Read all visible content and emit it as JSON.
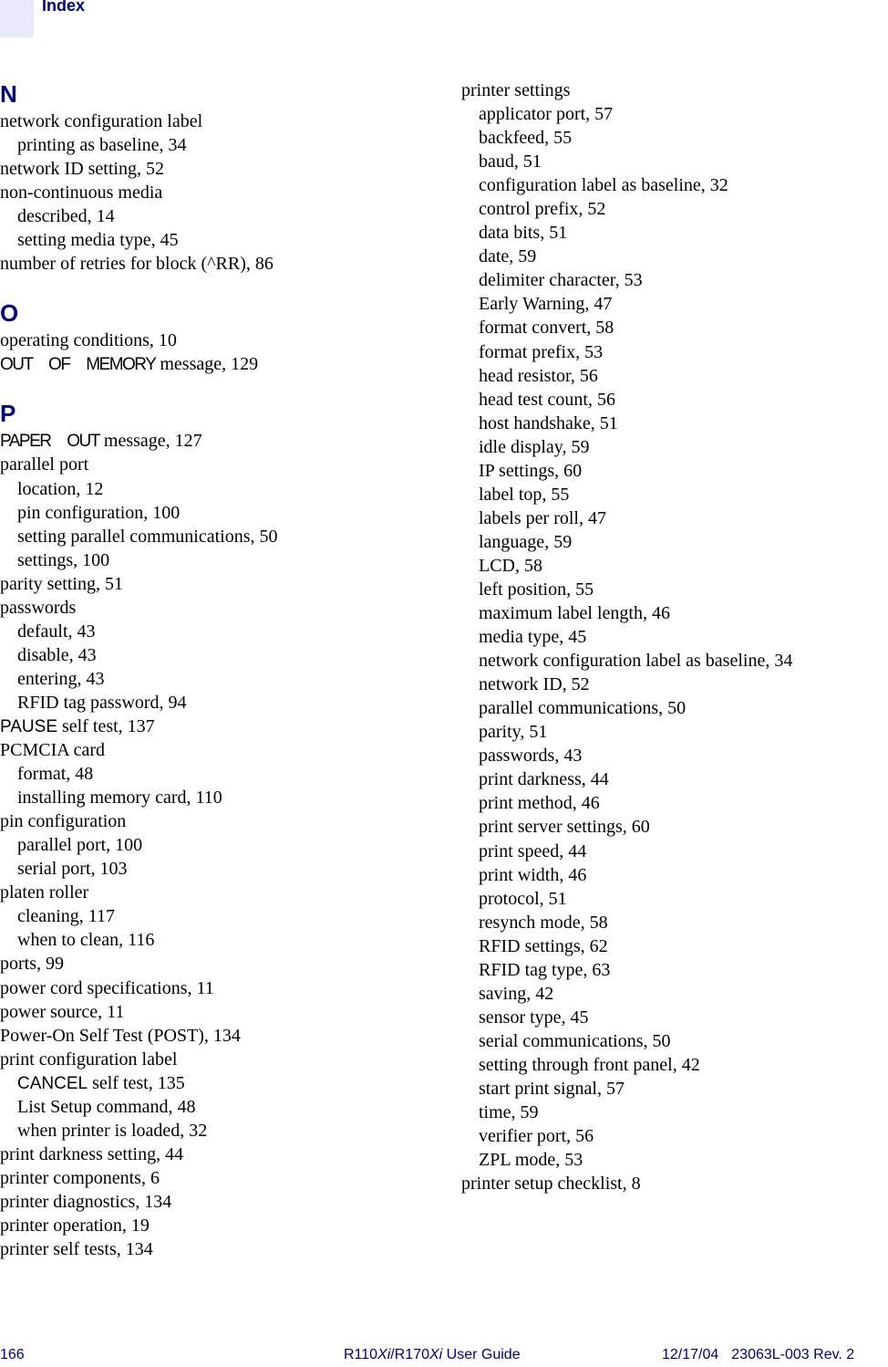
{
  "header": {
    "title": "Index"
  },
  "left_column": [
    {
      "type": "letter",
      "text": "N"
    },
    {
      "type": "entry",
      "level": 0,
      "text": "network configuration label"
    },
    {
      "type": "entry",
      "level": 1,
      "text": "printing as baseline, 34"
    },
    {
      "type": "entry",
      "level": 0,
      "text": "network ID setting, 52"
    },
    {
      "type": "entry",
      "level": 0,
      "text": "non-continuous media"
    },
    {
      "type": "entry",
      "level": 1,
      "text": "described, 14"
    },
    {
      "type": "entry",
      "level": 1,
      "text": "setting media type, 45"
    },
    {
      "type": "entry",
      "level": 0,
      "text": "number of retries for block (^RR), 86"
    },
    {
      "type": "gap"
    },
    {
      "type": "letter",
      "text": "O"
    },
    {
      "type": "entry",
      "level": 0,
      "text": "operating conditions, 10"
    },
    {
      "type": "entry",
      "level": 0,
      "sans": "OUT OF MEMORY",
      "condensed": true,
      "text": " message, 129"
    },
    {
      "type": "gap"
    },
    {
      "type": "letter",
      "text": "P"
    },
    {
      "type": "entry",
      "level": 0,
      "sans": "PAPER OUT",
      "condensed": true,
      "text": " message, 127"
    },
    {
      "type": "entry",
      "level": 0,
      "text": "parallel port"
    },
    {
      "type": "entry",
      "level": 1,
      "text": "location, 12"
    },
    {
      "type": "entry",
      "level": 1,
      "text": "pin configuration, 100"
    },
    {
      "type": "entry",
      "level": 1,
      "text": "setting parallel communications, 50"
    },
    {
      "type": "entry",
      "level": 1,
      "text": "settings, 100"
    },
    {
      "type": "entry",
      "level": 0,
      "text": "parity setting, 51"
    },
    {
      "type": "entry",
      "level": 0,
      "text": "passwords"
    },
    {
      "type": "entry",
      "level": 1,
      "text": "default, 43"
    },
    {
      "type": "entry",
      "level": 1,
      "text": "disable, 43"
    },
    {
      "type": "entry",
      "level": 1,
      "text": "entering, 43"
    },
    {
      "type": "entry",
      "level": 1,
      "text": "RFID tag password, 94"
    },
    {
      "type": "entry",
      "level": 0,
      "sans": "PAUSE",
      "text": " self test, 137"
    },
    {
      "type": "entry",
      "level": 0,
      "text": "PCMCIA card"
    },
    {
      "type": "entry",
      "level": 1,
      "text": "format, 48"
    },
    {
      "type": "entry",
      "level": 1,
      "text": "installing memory card, 110"
    },
    {
      "type": "entry",
      "level": 0,
      "text": "pin configuration"
    },
    {
      "type": "entry",
      "level": 1,
      "text": "parallel port, 100"
    },
    {
      "type": "entry",
      "level": 1,
      "text": "serial port, 103"
    },
    {
      "type": "entry",
      "level": 0,
      "text": "platen roller"
    },
    {
      "type": "entry",
      "level": 1,
      "text": "cleaning, 117"
    },
    {
      "type": "entry",
      "level": 1,
      "text": "when to clean, 116"
    },
    {
      "type": "entry",
      "level": 0,
      "text": "ports, 99"
    },
    {
      "type": "entry",
      "level": 0,
      "text": "power cord specifications, 11"
    },
    {
      "type": "entry",
      "level": 0,
      "text": "power source, 11"
    },
    {
      "type": "entry",
      "level": 0,
      "text": "Power-On Self Test (POST), 134"
    },
    {
      "type": "entry",
      "level": 0,
      "text": "print configuration label"
    },
    {
      "type": "entry",
      "level": 1,
      "sans": "CANCEL",
      "text": " self test, 135"
    },
    {
      "type": "entry",
      "level": 1,
      "text": "List Setup command, 48"
    },
    {
      "type": "entry",
      "level": 1,
      "text": "when printer is loaded, 32"
    },
    {
      "type": "entry",
      "level": 0,
      "text": "print darkness setting, 44"
    },
    {
      "type": "entry",
      "level": 0,
      "text": "printer components, 6"
    },
    {
      "type": "entry",
      "level": 0,
      "text": "printer diagnostics, 134"
    },
    {
      "type": "entry",
      "level": 0,
      "text": "printer operation, 19"
    },
    {
      "type": "entry",
      "level": 0,
      "text": "printer self tests, 134"
    }
  ],
  "right_column": [
    {
      "type": "entry",
      "level": 0,
      "text": "printer settings"
    },
    {
      "type": "entry",
      "level": 1,
      "text": "applicator port, 57"
    },
    {
      "type": "entry",
      "level": 1,
      "text": "backfeed, 55"
    },
    {
      "type": "entry",
      "level": 1,
      "text": "baud, 51"
    },
    {
      "type": "entry",
      "level": 1,
      "text": "configuration label as baseline, 32"
    },
    {
      "type": "entry",
      "level": 1,
      "text": "control prefix, 52"
    },
    {
      "type": "entry",
      "level": 1,
      "text": "data bits, 51"
    },
    {
      "type": "entry",
      "level": 1,
      "text": "date, 59"
    },
    {
      "type": "entry",
      "level": 1,
      "text": "delimiter character, 53"
    },
    {
      "type": "entry",
      "level": 1,
      "text": "Early Warning, 47"
    },
    {
      "type": "entry",
      "level": 1,
      "text": "format convert, 58"
    },
    {
      "type": "entry",
      "level": 1,
      "text": "format prefix, 53"
    },
    {
      "type": "entry",
      "level": 1,
      "text": "head resistor, 56"
    },
    {
      "type": "entry",
      "level": 1,
      "text": "head test count, 56"
    },
    {
      "type": "entry",
      "level": 1,
      "text": "host handshake, 51"
    },
    {
      "type": "entry",
      "level": 1,
      "text": "idle display, 59"
    },
    {
      "type": "entry",
      "level": 1,
      "text": "IP settings, 60"
    },
    {
      "type": "entry",
      "level": 1,
      "text": "label top, 55"
    },
    {
      "type": "entry",
      "level": 1,
      "text": "labels per roll, 47"
    },
    {
      "type": "entry",
      "level": 1,
      "text": "language, 59"
    },
    {
      "type": "entry",
      "level": 1,
      "text": "LCD, 58"
    },
    {
      "type": "entry",
      "level": 1,
      "text": "left position, 55"
    },
    {
      "type": "entry",
      "level": 1,
      "text": "maximum label length, 46"
    },
    {
      "type": "entry",
      "level": 1,
      "text": "media type, 45"
    },
    {
      "type": "entry",
      "level": 1,
      "text": "network configuration label as baseline, 34"
    },
    {
      "type": "entry",
      "level": 1,
      "text": "network ID, 52"
    },
    {
      "type": "entry",
      "level": 1,
      "text": "parallel communications, 50"
    },
    {
      "type": "entry",
      "level": 1,
      "text": "parity, 51"
    },
    {
      "type": "entry",
      "level": 1,
      "text": "passwords, 43"
    },
    {
      "type": "entry",
      "level": 1,
      "text": "print darkness, 44"
    },
    {
      "type": "entry",
      "level": 1,
      "text": "print method, 46"
    },
    {
      "type": "entry",
      "level": 1,
      "text": "print server settings, 60"
    },
    {
      "type": "entry",
      "level": 1,
      "text": "print speed, 44"
    },
    {
      "type": "entry",
      "level": 1,
      "text": "print width, 46"
    },
    {
      "type": "entry",
      "level": 1,
      "text": "protocol, 51"
    },
    {
      "type": "entry",
      "level": 1,
      "text": "resynch mode, 58"
    },
    {
      "type": "entry",
      "level": 1,
      "text": "RFID settings, 62"
    },
    {
      "type": "entry",
      "level": 1,
      "text": "RFID tag type, 63"
    },
    {
      "type": "entry",
      "level": 1,
      "text": "saving, 42"
    },
    {
      "type": "entry",
      "level": 1,
      "text": "sensor type, 45"
    },
    {
      "type": "entry",
      "level": 1,
      "text": "serial communications, 50"
    },
    {
      "type": "entry",
      "level": 1,
      "text": "setting through front panel, 42"
    },
    {
      "type": "entry",
      "level": 1,
      "text": "start print signal, 57"
    },
    {
      "type": "entry",
      "level": 1,
      "text": "time, 59"
    },
    {
      "type": "entry",
      "level": 1,
      "text": "verifier port, 56"
    },
    {
      "type": "entry",
      "level": 1,
      "text": "ZPL mode, 53"
    },
    {
      "type": "entry",
      "level": 0,
      "text": "printer setup checklist, 8"
    }
  ],
  "footer": {
    "page_number": "166",
    "guide_title_prefix": "R110",
    "guide_title_italic1": "Xi",
    "guide_title_mid": "/R170",
    "guide_title_italic2": "Xi",
    "guide_title_suffix": " User Guide",
    "date": "12/17/04",
    "doc_id": "23063L-003 Rev. 2"
  }
}
